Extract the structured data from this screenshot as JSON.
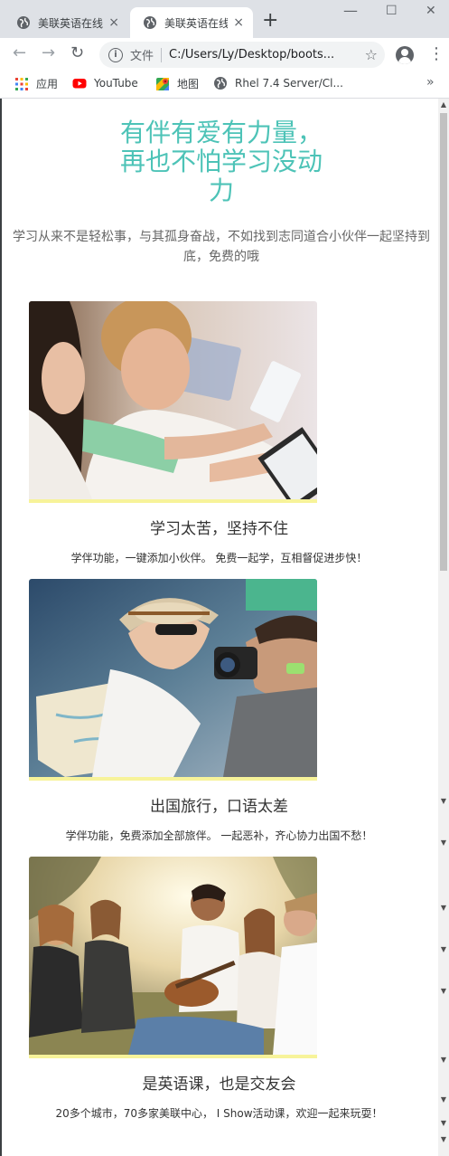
{
  "browser": {
    "tabs": [
      {
        "title": "美联英语在线",
        "close": "×",
        "active": false
      },
      {
        "title": "美联英语在线",
        "close": "×",
        "active": true
      }
    ],
    "new_tab": "+",
    "window_controls": {
      "minimize": "—",
      "maximize": "☐",
      "close": "✕"
    },
    "nav": {
      "back": "←",
      "forward": "→",
      "reload": "↻"
    },
    "address": {
      "scheme_label": "文件",
      "url": "C:/Users/Ly/Desktop/boots...",
      "info": "i",
      "star": "☆"
    },
    "menu": "⋮",
    "bookmarks": [
      {
        "label": "应用",
        "icon": "apps-grid-icon"
      },
      {
        "label": "YouTube",
        "icon": "youtube-icon"
      },
      {
        "label": "地图",
        "icon": "maps-icon"
      },
      {
        "label": "Rhel 7.4 Server/Cl...",
        "icon": "globe-icon"
      }
    ],
    "bookmarks_more": "»"
  },
  "page": {
    "hero": {
      "title": "有伴有爱有力量，再也不怕学习没动力",
      "subtitle": "学习从来不是轻松事，与其孤身奋战，不如找到志同道合小伙伴一起坚持到底，免费的哦"
    },
    "features": [
      {
        "title": "学习太苦，坚持不住",
        "description": "学伴功能，一键添加小伙伴。 免费一起学，互相督促进步快！",
        "image": "students-studying-with-tablet-photo"
      },
      {
        "title": "出国旅行，口语太差",
        "description": "学伴功能，免费添加全部旅伴。 一起恶补，齐心协力出国不愁！",
        "image": "travelers-with-map-and-camera-photo"
      },
      {
        "title": "是英语课，也是交友会",
        "description": "20多个城市，70多家美联中心， I Show活动课，欢迎一起来玩耍！",
        "image": "friends-with-guitar-outdoors-photo"
      }
    ]
  },
  "colors": {
    "accent": "#4dc3b7",
    "image_underline": "#f7f39a",
    "text": "#333333",
    "subtitle": "#666666",
    "tabbar": "#dee1e6"
  }
}
